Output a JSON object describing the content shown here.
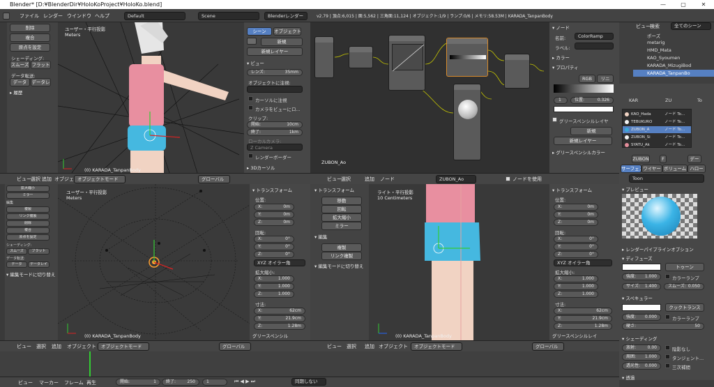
{
  "window": {
    "title": "Blender* [D:¥BlenderDir¥HoloKoProject¥HoloKo.blend]",
    "controls": [
      "—",
      "▢",
      "✕"
    ]
  },
  "info": {
    "menus": [
      "ファイル",
      "レンダー",
      "ウインドウ",
      "ヘルプ"
    ],
    "layout": "Default",
    "scene": "Scene",
    "engine": "Blenderレンダー",
    "stats": "v2.79 | 頂点:6,015 | 面:5,562 | 三角面:11,124 | オブジェクト:1/9 | ランプ:0/6 | メモリ:58.53M | KARADA_TanpanBody"
  },
  "tool_shelf": {
    "buttons": [
      "削除",
      "複合",
      "原点を設定"
    ],
    "shading_label": "シェーディング:",
    "smooth": "スムーズ",
    "flat": "フラット",
    "data_transfer_label": "データ転送:",
    "data": "データ",
    "data2": "データレ",
    "history": "▸ 履歴"
  },
  "viewport_top": {
    "view_name": "ユーザー・平行投影",
    "units": "Meters",
    "object": "(0) KARADA_TanpanBody"
  },
  "properties_top": {
    "tabs": [
      "シーン",
      "オブジェクト"
    ],
    "new": "新規",
    "new_layer": "新規レイヤー",
    "view_section": "▾ ビュー",
    "lens_label": "レンズ:",
    "lens_value": "35mm",
    "lock_label": "オブジェクトに注視:",
    "lock_cursor": "カーソルに注視",
    "lock_camera": "カメラをビューにロ...",
    "clip_label": "クリップ:",
    "clip_start_label": "開始:",
    "clip_start": "10cm",
    "clip_end_label": "終了:",
    "clip_end": "1km",
    "local_camera": "ローカルカメラ:",
    "camera_field": "Z Camera",
    "render_border": "レンダーボーダー",
    "cursor_section": "▸ 3Dカーソル"
  },
  "node_editor": {
    "material": "ZUBON_Ao",
    "menus": [
      "ビュー",
      "選択",
      "追加",
      "ノード"
    ],
    "use_nodes": "ノードを使用",
    "frame": "1"
  },
  "node_props": {
    "section": "▾ ノード",
    "name_label": "名前:",
    "name_value": "ColorRamp",
    "label_label": "ラベル:",
    "color_section": "▸ カラー",
    "props_section": "▾ プロパティ",
    "rgb": "RGB",
    "linear": "リニ",
    "pos_label": "位置:",
    "pos_value": "0.326",
    "index": "1",
    "gp_section": "グリースペンシルレイヤ",
    "gp_new": "新規",
    "gp_new_layer": "新規レイヤー",
    "gp_colors": "▸ グリースペンシルカラー"
  },
  "outliner": {
    "menus": [
      "ビュー",
      "検索"
    ],
    "filter": "全てのシーン",
    "items": [
      "ポーズ",
      "metarig",
      "HMD_Mata",
      "KAO_Syoumen",
      "KARADA_MizugiBod",
      "KARADA_TanpanBo"
    ]
  },
  "material_props": {
    "breadcrumb": [
      "KAR",
      "ZU",
      "To"
    ],
    "slots": [
      {
        "name": "KAO_Hada",
        "node": "ノード To...",
        "color": "#f1d3c3"
      },
      {
        "name": "TEBUKURO",
        "node": "ノード To...",
        "color": "#f2f2f2"
      },
      {
        "name": "ZUBON_A",
        "node": "ノード To...",
        "color": "#3aa9d6"
      },
      {
        "name": "ZUBON_Si",
        "node": "ノード To...",
        "color": "#f2f2f2"
      },
      {
        "name": "SYATU_Ak",
        "node": "ノード To...",
        "color": "#e38d9a"
      }
    ],
    "material_field": "ZUBON",
    "material_suffix": "F",
    "data_btn": "デー",
    "tabs": [
      "サーフェス",
      "ワイヤー",
      "ボリューム",
      "ハロー"
    ],
    "toon_field": "Toon",
    "preview_section": "▾ プレビュー",
    "render_pipeline": "▸ レンダーパイプラインオプション",
    "diffuse_section": "▾ ディフューズ",
    "diffuse_shader": "トゥーン",
    "intensity_label": "強度:",
    "intensity": "1.000",
    "ramp_label": "カラーランプ",
    "size_label": "サイズ:",
    "size": "1.400",
    "smooth_label": "スムーズ:",
    "smooth": "0.050",
    "specular_section": "▾ スペキュラー",
    "specular_shader": "クックトランス",
    "spec_intensity": "0.000",
    "hardness_label": "硬さ:",
    "hardness": "50",
    "shading_section": "▾ シェーディング",
    "emit_label": "放射:",
    "emit": "0.00",
    "shadeless": "陰影なし",
    "ambient_label": "周囲:",
    "ambient": "1.000",
    "tangent": "タンジェント...",
    "translucency_label": "透光性:",
    "translucency": "0.000",
    "cubic": "三次補間",
    "transparency_section": "▾ 透過"
  },
  "viewport_bl": {
    "view_name": "ユーザー・平行投影",
    "units": "Meters",
    "object": "(0) KARADA_TanpanBody"
  },
  "viewport_br": {
    "view_name": "ライト・平行投影",
    "units": "10 Centimeters",
    "object": "(0) KARADA_TanpanBody"
  },
  "bl_tool_shelf": {
    "items": [
      "拡大縮小",
      "ミラー",
      "編集",
      "複製",
      "リンク複製",
      "削除",
      "複合",
      "原点を設定"
    ],
    "shading": "シェーディング:",
    "smooth": "スムーズ",
    "flat": "フラット",
    "data_transfer": "データ転送:",
    "data": "データ",
    "data2": "データレイ",
    "mode_switch": "▾ 編集モードに切り替え"
  },
  "transform_bl": {
    "section": "▾ トランスフォーム",
    "location": "位置:",
    "loc": [
      "0m",
      "0m",
      "0m"
    ],
    "rotation": "回転:",
    "rot": [
      "0°",
      "0°",
      "0°"
    ],
    "euler": "XYZ オイラー角",
    "scale": "拡大縮小:",
    "scl": [
      "1.000",
      "1.000",
      "1.000"
    ],
    "dimensions": "寸法:",
    "dim": [
      "62cm",
      "21.9cm",
      "1.28m"
    ],
    "gp": "グリースペンシル"
  },
  "transform_br": {
    "section": "▾ トランスフォーム",
    "location": "位置:",
    "loc": [
      "0m",
      "0m",
      "0m"
    ],
    "rotation": "回転:",
    "rot": [
      "0°",
      "0°",
      "0°"
    ],
    "euler": "XYZ オイラー角",
    "scale": "拡大縮小:",
    "scl": [
      "1.000",
      "1.000",
      "1.000"
    ],
    "dimensions": "寸法:",
    "dim": [
      "62cm",
      "21.9cm",
      "1.28m"
    ],
    "gp": "グリースペンシルレイ"
  },
  "br_tool_shelf": {
    "transform_section": "▾ トランスフォーム",
    "items": [
      "移動",
      "回転",
      "拡大縮小",
      "ミラー"
    ],
    "edit_section": "▾ 編集",
    "edit_items": [
      "複製",
      "リンク複製"
    ],
    "mode_switch": "▾ 編集モードに切り替え"
  },
  "axes": [
    "X:",
    "Y:",
    "Z:"
  ],
  "vp_header": {
    "menus": [
      "ビュー",
      "選択",
      "追加",
      "オブジェクト"
    ],
    "mode": "オブジェクトモード",
    "orientation": "グローバル"
  },
  "timeline": {
    "menus": [
      "ビュー",
      "マーカー",
      "フレーム",
      "再生"
    ],
    "start_label": "開始:",
    "start": "1",
    "end_label": "終了:",
    "end": "250",
    "current": "1",
    "sync": "同期しない"
  },
  "colors": {
    "accent": "#5680c2",
    "background": "#3d3d3d",
    "panel": "#474747",
    "viewport": "#393939"
  }
}
